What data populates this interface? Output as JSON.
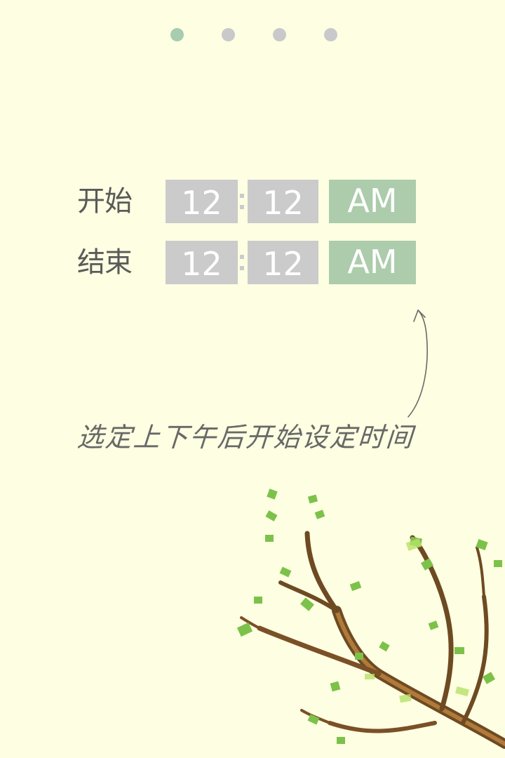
{
  "pager": {
    "pages": 4,
    "active_index": 0
  },
  "schedule": {
    "start": {
      "label": "开始",
      "hour": "12",
      "minute": "12",
      "ampm": "AM"
    },
    "end": {
      "label": "结束",
      "hour": "12",
      "minute": "12",
      "ampm": "AM"
    }
  },
  "hint": {
    "text": "选定上下午后开始设定时间"
  },
  "colors": {
    "background": "#fefee2",
    "time_box": "#cbcbcc",
    "ampm_box": "#acccac",
    "dot_active": "#a6cdb0",
    "dot_inactive": "#c9c9cc",
    "label_text": "#5a5a5a"
  },
  "icons": {
    "arrow": "curved-up-arrow-icon",
    "illustration": "tree-branch-illustration"
  }
}
